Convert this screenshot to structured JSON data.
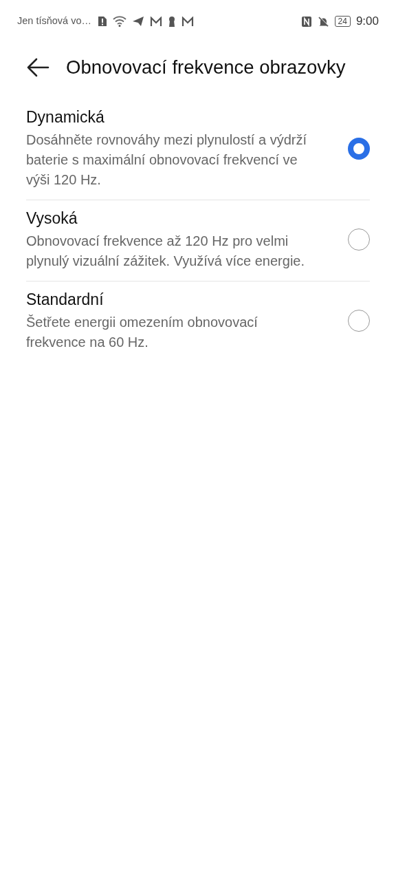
{
  "status_bar": {
    "carrier": "Jen tísňová vo…",
    "battery": "24",
    "time": "9:00"
  },
  "header": {
    "title": "Obnovovací frekvence obrazovky"
  },
  "options": [
    {
      "title": "Dynamická",
      "description": "Dosáhněte rovnováhy mezi plynulostí a výdrží baterie s maximální obnovovací frekvencí ve výši 120 Hz.",
      "selected": true
    },
    {
      "title": "Vysoká",
      "description": "Obnovovací frekvence až 120 Hz pro velmi plynulý vizuální zážitek. Využívá více energie.",
      "selected": false
    },
    {
      "title": "Standardní",
      "description": "Šetřete energii omezením obnovovací frekvence na 60 Hz.",
      "selected": false
    }
  ]
}
